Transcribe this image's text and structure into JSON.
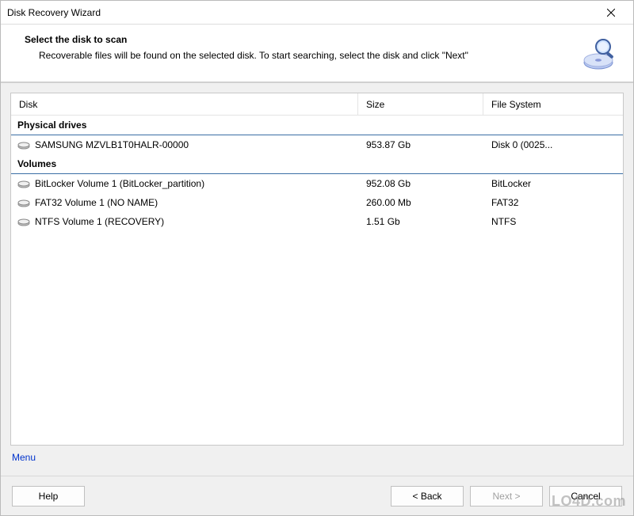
{
  "window": {
    "title": "Disk Recovery Wizard"
  },
  "header": {
    "title": "Select the disk to scan",
    "subtitle": "Recoverable files will be found on the selected disk. To start searching, select the disk and click \"Next\""
  },
  "table": {
    "columns": {
      "disk": "Disk",
      "size": "Size",
      "fs": "File System"
    },
    "group_physical": "Physical drives",
    "group_volumes": "Volumes",
    "physical": [
      {
        "name": "SAMSUNG MZVLB1T0HALR-00000",
        "size": "953.87 Gb",
        "fs": "Disk 0 (0025..."
      }
    ],
    "volumes": [
      {
        "name": "BitLocker Volume 1 (BitLocker_partition)",
        "size": "952.08 Gb",
        "fs": "BitLocker"
      },
      {
        "name": "FAT32 Volume 1 (NO NAME)",
        "size": "260.00 Mb",
        "fs": "FAT32"
      },
      {
        "name": "NTFS Volume 1 (RECOVERY)",
        "size": "1.51 Gb",
        "fs": "NTFS"
      }
    ]
  },
  "menu_label": "Menu",
  "buttons": {
    "help": "Help",
    "back": "< Back",
    "next": "Next >",
    "cancel": "Cancel"
  },
  "watermark": "LO4D.com"
}
